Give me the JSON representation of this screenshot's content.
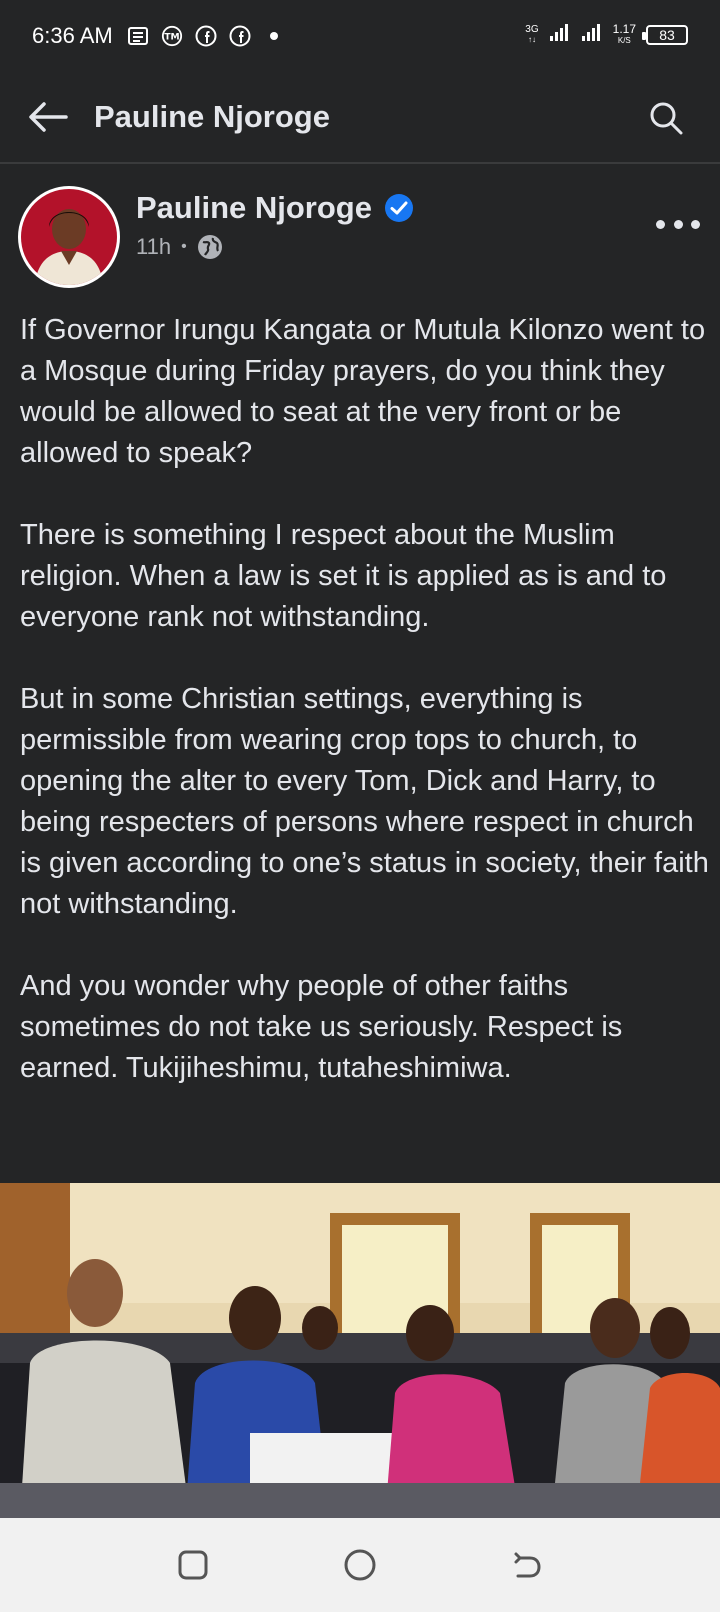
{
  "status_bar": {
    "time": "6:36 AM",
    "network_type": "3G",
    "speed_value": "1.17",
    "speed_unit": "K/S",
    "battery": "83",
    "notification_icons": [
      "news-icon",
      "tm-icon",
      "facebook-icon",
      "facebook-icon",
      "dot-icon"
    ]
  },
  "app_bar": {
    "title": "Pauline Njoroge"
  },
  "post": {
    "author": "Pauline Njoroge",
    "verified": true,
    "time_ago": "11h",
    "audience_icon": "globe-icon",
    "paragraphs": [
      "If Governor Irungu Kangata or Mutula Kilonzo went to a Mosque during Friday prayers, do you think they would be allowed to seat at the very front or be allowed to speak?",
      "There is something I respect about the Muslim religion. When a law is set it is applied as is and to everyone rank not withstanding.",
      "But in some Christian settings, everything is permissible from wearing crop tops to church, to opening the alter to every Tom, Dick and Harry, to being respecters of persons where respect in church is given according to one’s status in society, their faith not withstanding.",
      "And you wonder why people of other faiths sometimes do not take us seriously. Respect is earned. Tukijiheshimu, tutaheshimiwa."
    ]
  },
  "colors": {
    "background": "#242526",
    "text": "#e4e6eb",
    "secondary_text": "#b0b3b8",
    "verified_blue": "#1877f2",
    "nav_bar": "#f1f1f1"
  }
}
